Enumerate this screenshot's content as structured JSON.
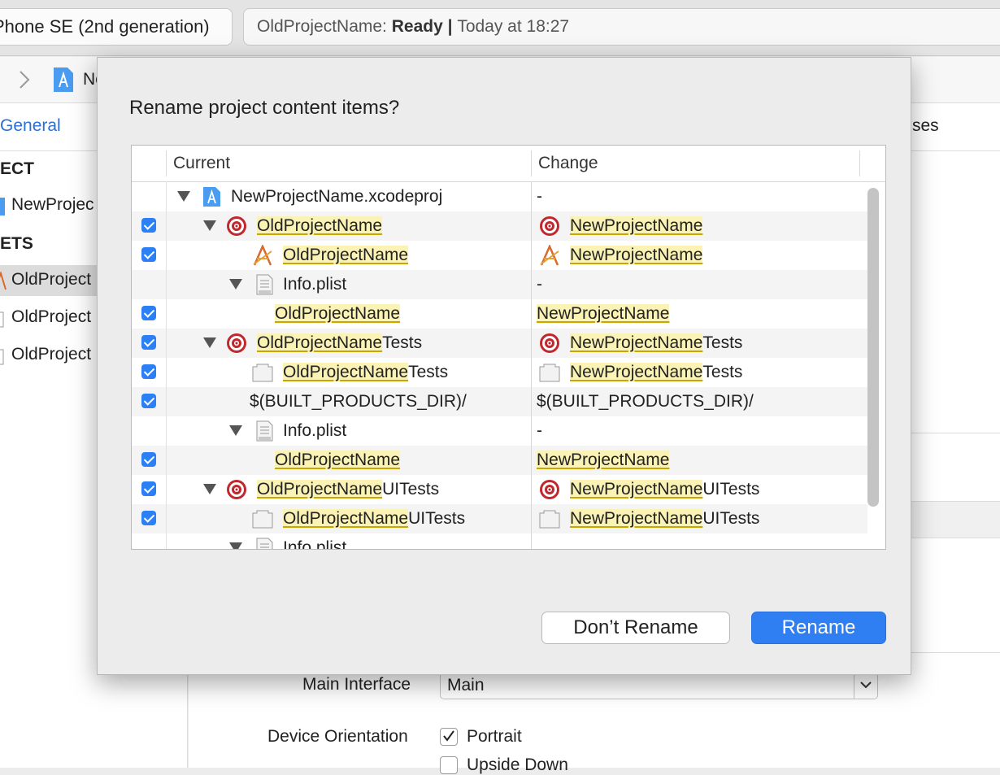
{
  "toolbar": {
    "scheme_device": "Phone SE (2nd generation)",
    "activity_project": "OldProjectName: ",
    "activity_status": "Ready",
    "activity_sep": " | ",
    "activity_time": "Today at 18:27"
  },
  "editor": {
    "jump_fragment": "Ne",
    "tab_general": "General",
    "tab_right_fragment": "ses",
    "section_project": "ECT",
    "project_item": "NewProjec",
    "section_targets": "ETS",
    "targets": [
      "OldProject",
      "OldProject",
      "OldProject"
    ],
    "main_interface_label": "Main Interface",
    "main_interface_value": "Main",
    "device_orientation_label": "Device Orientation",
    "orientation_portrait": "Portrait",
    "orientation_upside_down": "Upside Down"
  },
  "dialog": {
    "title": "Rename project content items?",
    "columns": {
      "current": "Current",
      "change": "Change"
    },
    "rows": [
      {
        "checked": false,
        "current": {
          "hl": "",
          "rest": "NewProjectName.xcodeproj"
        },
        "change": {
          "hl": "",
          "rest": "-"
        },
        "icon": "xcodeproj-icon"
      },
      {
        "checked": true,
        "current": {
          "hl": "OldProjectName",
          "rest": ""
        },
        "change": {
          "hl": "NewProjectName",
          "rest": ""
        },
        "icon": "target-icon"
      },
      {
        "checked": true,
        "current": {
          "hl": "OldProjectName",
          "rest": ""
        },
        "change": {
          "hl": "NewProjectName",
          "rest": ""
        },
        "icon": "app-icon"
      },
      {
        "checked": false,
        "current": {
          "hl": "",
          "rest": "Info.plist"
        },
        "change": {
          "hl": "",
          "rest": "-"
        },
        "icon": "plist-icon"
      },
      {
        "checked": true,
        "current": {
          "hl": "OldProjectName",
          "rest": ""
        },
        "change": {
          "hl": "NewProjectName",
          "rest": ""
        },
        "icon": ""
      },
      {
        "checked": true,
        "current": {
          "hl": "OldProjectName",
          "rest": "Tests"
        },
        "change": {
          "hl": "NewProjectName",
          "rest": "Tests"
        },
        "icon": "target-icon"
      },
      {
        "checked": true,
        "current": {
          "hl": "OldProjectName",
          "rest": "Tests"
        },
        "change": {
          "hl": "NewProjectName",
          "rest": "Tests"
        },
        "icon": "bundle-icon"
      },
      {
        "checked": true,
        "current": {
          "hl": "",
          "rest": "$(BUILT_PRODUCTS_DIR)/"
        },
        "change": {
          "hl": "",
          "rest": "$(BUILT_PRODUCTS_DIR)/"
        },
        "icon": ""
      },
      {
        "checked": false,
        "current": {
          "hl": "",
          "rest": "Info.plist"
        },
        "change": {
          "hl": "",
          "rest": "-"
        },
        "icon": "plist-icon"
      },
      {
        "checked": true,
        "current": {
          "hl": "OldProjectName",
          "rest": ""
        },
        "change": {
          "hl": "NewProjectName",
          "rest": ""
        },
        "icon": ""
      },
      {
        "checked": true,
        "current": {
          "hl": "OldProjectName",
          "rest": "UITests"
        },
        "change": {
          "hl": "NewProjectName",
          "rest": "UITests"
        },
        "icon": "target-icon"
      },
      {
        "checked": true,
        "current": {
          "hl": "OldProjectName",
          "rest": "UITests"
        },
        "change": {
          "hl": "NewProjectName",
          "rest": "UITests"
        },
        "icon": "bundle-icon"
      },
      {
        "checked": false,
        "current": {
          "hl": "",
          "rest": "Info.plist"
        },
        "change": {
          "hl": "",
          "rest": ""
        },
        "icon": "plist-icon"
      }
    ],
    "buttons": {
      "dont_rename": "Don’t Rename",
      "rename": "Rename"
    }
  },
  "colors": {
    "accent": "#2f7ff3",
    "highlight": "#fbf3b5",
    "target_red": "#c0282d"
  }
}
